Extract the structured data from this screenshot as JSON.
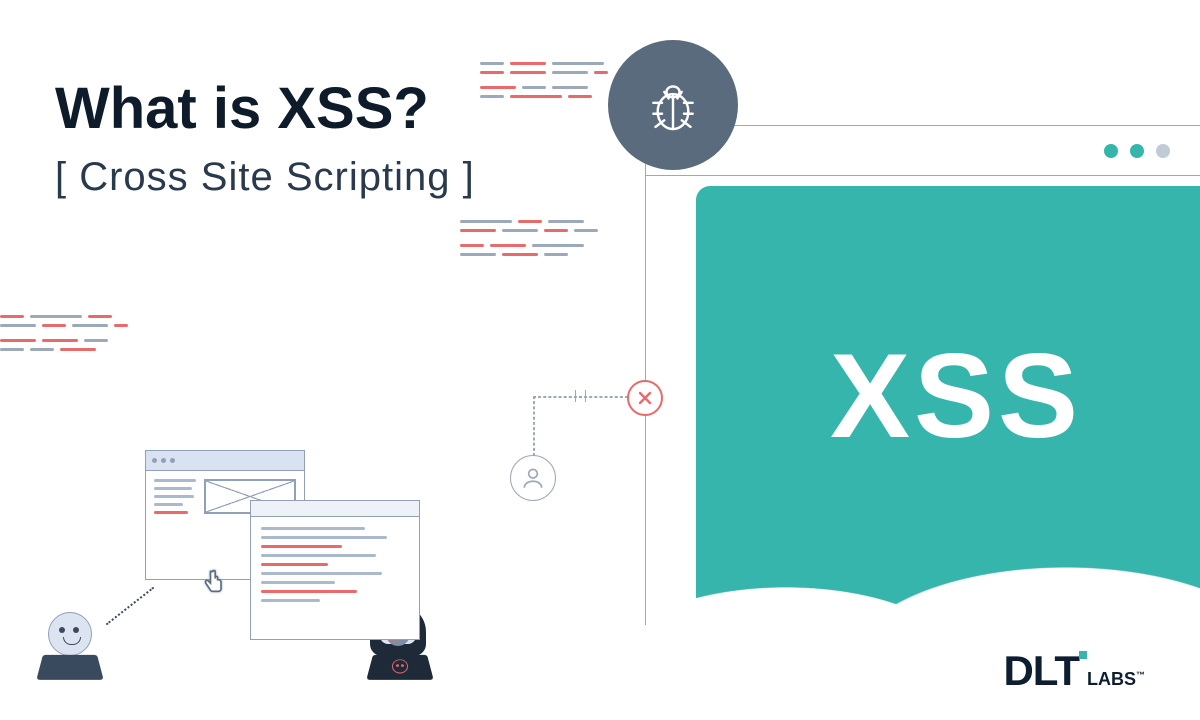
{
  "title": "What is XSS?",
  "subtitle": "[ Cross Site Scripting ]",
  "xss_label": "XSS",
  "logo": {
    "main": "DLT",
    "sub": "LABS",
    "tm": "™"
  },
  "icons": {
    "bug": "bug-icon",
    "close": "close-icon",
    "user": "user-icon",
    "pointer": "hand-pointer-icon"
  },
  "colors": {
    "teal": "#36b5ac",
    "dark": "#0d1b2a",
    "grey": "#9ca9b8",
    "red": "#e96a6a",
    "slate": "#5a6b7d"
  }
}
